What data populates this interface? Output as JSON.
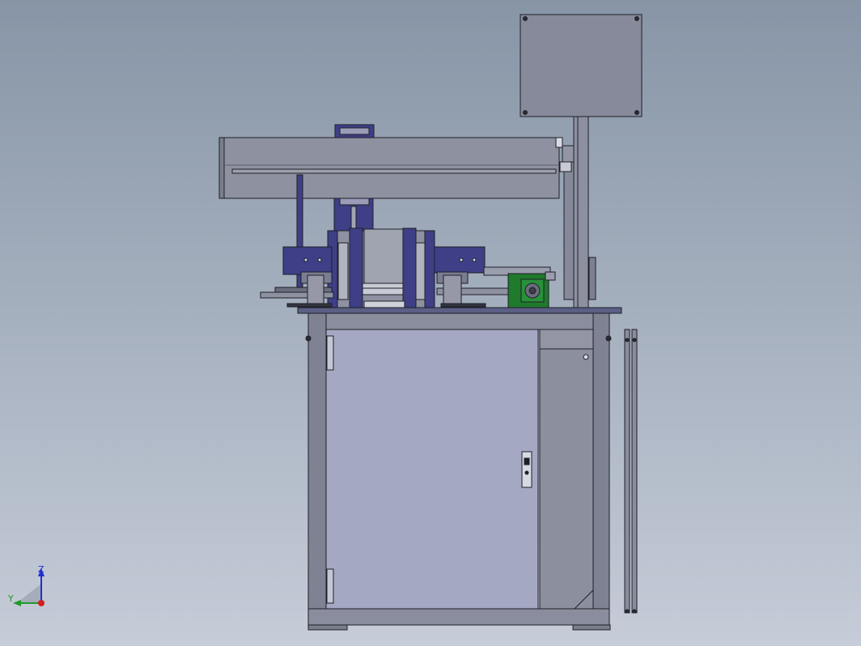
{
  "viewport": {
    "background_top": "#8795a6",
    "background_bottom": "#c6ccd8"
  },
  "model": {
    "colors": {
      "frame": "#7e8494",
      "frame_dark": "#4b5060",
      "panel": "#8a8fa0",
      "door": "#a4a8c3",
      "side_panel": "#8c8f9e",
      "beam": "#8d90a0",
      "motor_blue": "#3e3f86",
      "motor_dark": "#2c2d66",
      "gear_green": "#1f7a2b",
      "outline": "#1e1f28",
      "table_top": "#5b5f85"
    },
    "icons": [
      "enclosure-door-handle-icon",
      "control-box-screw-icon",
      "gear-motor-icon"
    ]
  },
  "triad": {
    "z_label": "Z",
    "y_label": "Y",
    "z_color": "#1f2fd0",
    "y_color": "#1e9a2a",
    "x_color": "#d02020"
  }
}
